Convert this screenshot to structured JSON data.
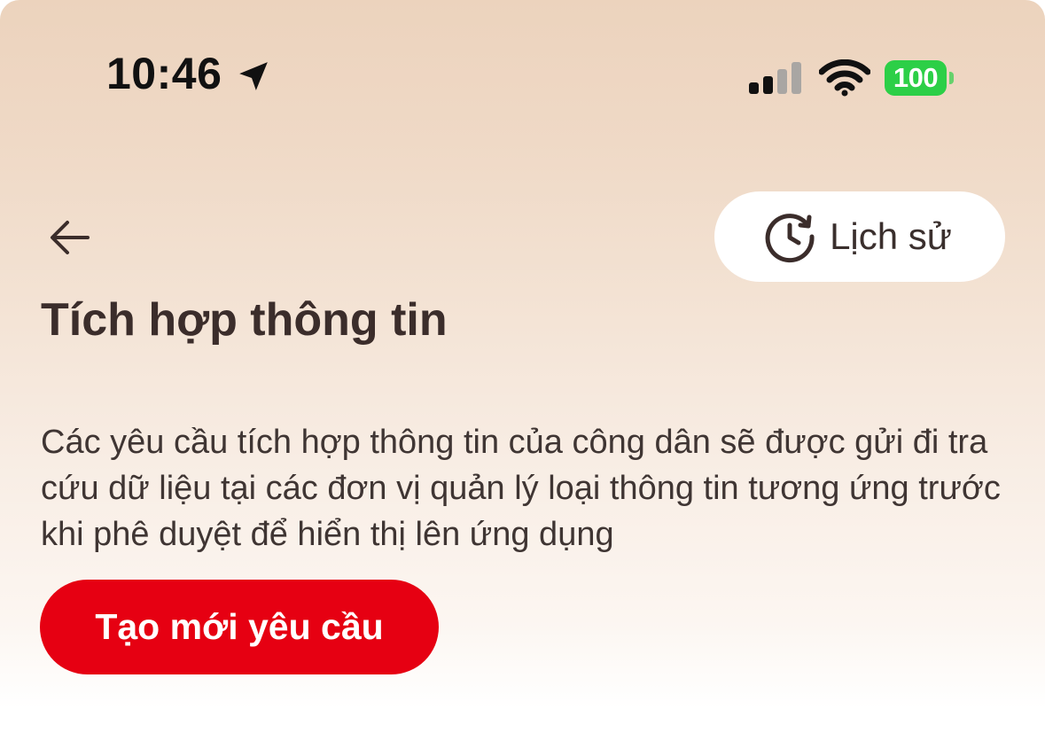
{
  "status_bar": {
    "time": "10:46",
    "battery_level": "100",
    "icons": [
      "location-arrow-icon",
      "cellular-signal-icon",
      "wifi-icon",
      "battery-icon"
    ],
    "battery_color": "#2ccf47",
    "signal_bars_active": 2,
    "signal_bars_total": 4
  },
  "header": {
    "back_icon": "arrow-left-icon",
    "history_icon": "history-clock-icon",
    "history_label": "Lịch sử"
  },
  "page": {
    "title": "Tích hợp thông tin",
    "description": "Các yêu cầu tích hợp thông tin của công dân sẽ được gửi đi tra cứu dữ liệu tại các đơn vị quản lý loại thông tin tương ứng trước khi phê duyệt để hiển thị lên ứng dụng"
  },
  "actions": {
    "create_label": "Tạo mới yêu cầu"
  },
  "colors": {
    "primary": "#e60012",
    "text_dark": "#3b2d2b",
    "background_top": "#ecd3bd"
  }
}
